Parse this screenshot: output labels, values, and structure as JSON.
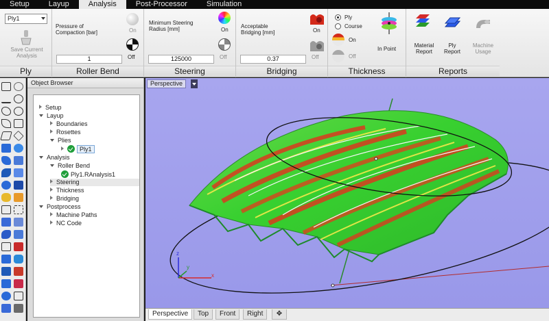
{
  "menu": {
    "tabs": [
      "Setup",
      "Layup",
      "Analysis",
      "Post-Processor",
      "Simulation"
    ],
    "active_index": 2
  },
  "ribbon": {
    "ply": {
      "selector_value": "Ply1",
      "save_label": "Save Current Analysis",
      "title": "Ply"
    },
    "roller_bend": {
      "param_label": "Pressure of Compaction [bar]",
      "value": "1",
      "on_label": "On",
      "off_label": "Off",
      "title": "Roller Bend"
    },
    "steering": {
      "param_label": "Minimum Steering Radius [mm]",
      "value": "125000",
      "on_label": "On",
      "off_label": "Off",
      "title": "Steering"
    },
    "bridging": {
      "param_label": "Acceptable Bridging [mm]",
      "value": "0.37",
      "on_label": "On",
      "off_label": "Off",
      "title": "Bridging"
    },
    "thickness": {
      "radio_ply": "Ply",
      "radio_course": "Course",
      "selected": "Ply",
      "on_label": "On",
      "off_label": "Off",
      "in_point_label": "In Point",
      "title": "Thickness"
    },
    "reports": {
      "material_report": "Material Report",
      "ply_report": "Ply Report",
      "machine_usage": "Machine Usage",
      "title": "Reports"
    }
  },
  "object_browser": {
    "title": "Object Browser",
    "nodes": {
      "setup": "Setup",
      "layup": "Layup",
      "boundaries": "Boundaries",
      "rosettes": "Rosettes",
      "plies": "Plies",
      "ply1": "Ply1",
      "analysis": "Analysis",
      "roller_bend": "Roller Bend",
      "ply1_analysis": "Ply1.RAnalysis1",
      "steering": "Steering",
      "thickness": "Thickness",
      "bridging": "Bridging",
      "postprocess": "Postprocess",
      "machine_paths": "Machine Paths",
      "nc_code": "NC Code"
    }
  },
  "viewport": {
    "current_view": "Perspective",
    "axis_labels": {
      "x": "x",
      "y": "y",
      "z": "z"
    },
    "view_tabs": [
      "Perspective",
      "Top",
      "Front",
      "Right"
    ],
    "active_view_tab": "Perspective",
    "colors": {
      "background": "#a8a6ef",
      "surface_green": "#43d43a",
      "surface_red": "#d93a1e",
      "surface_yellow": "#d8e83a"
    }
  }
}
